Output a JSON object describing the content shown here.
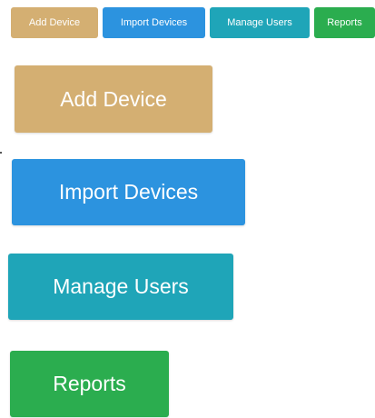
{
  "toolbar": {
    "buttons": [
      {
        "label": "Add Device",
        "color": "#d4af72"
      },
      {
        "label": "Import Devices",
        "color": "#2c93df"
      },
      {
        "label": "Manage Users",
        "color": "#1fa5b8"
      },
      {
        "label": "Reports",
        "color": "#2bad4f"
      }
    ]
  },
  "large": {
    "buttons": [
      {
        "label": "Add Device",
        "color": "#d4af72"
      },
      {
        "label": "Import Devices",
        "color": "#2c93df"
      },
      {
        "label": "Manage Users",
        "color": "#1fa5b8"
      },
      {
        "label": "Reports",
        "color": "#2bad4f"
      }
    ]
  }
}
